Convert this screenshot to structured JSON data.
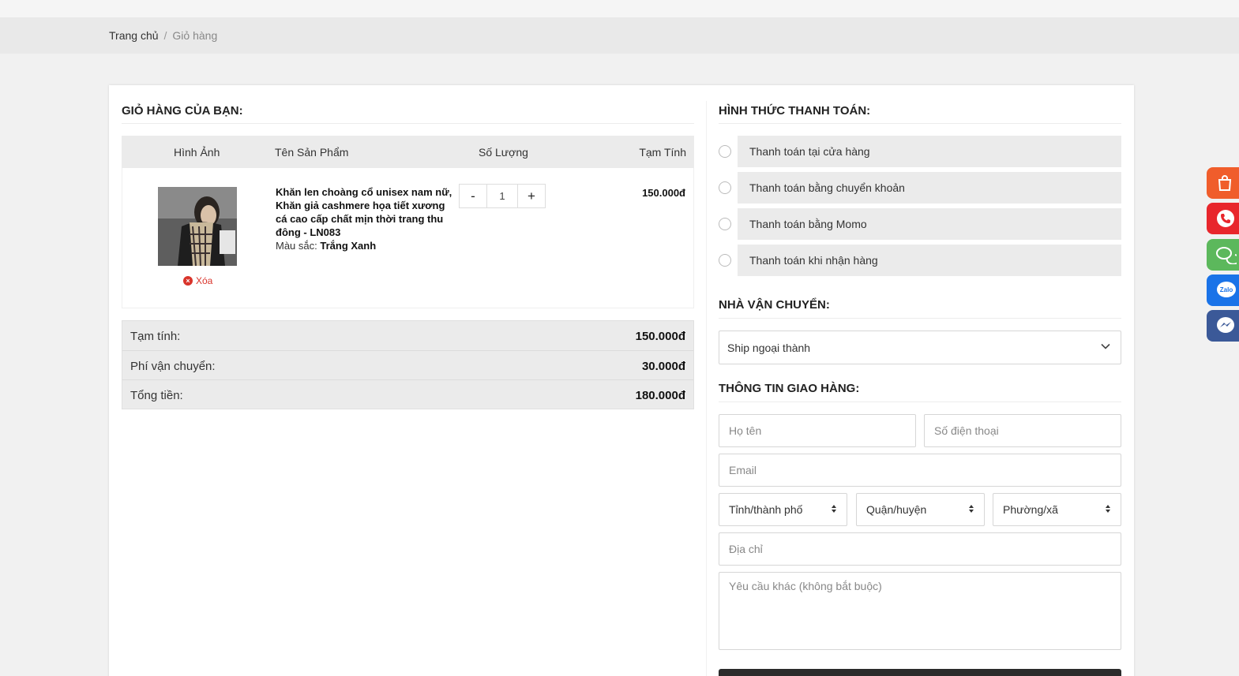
{
  "breadcrumb": {
    "home": "Trang chủ",
    "separator": "/",
    "current": "Giỏ hàng"
  },
  "cart": {
    "title": "GIỎ HÀNG CỦA BẠN:",
    "columns": [
      "Hình Ảnh",
      "Tên Sản Phẩm",
      "Số Lượng",
      "Tạm Tính"
    ],
    "item": {
      "name": "Khăn len choàng cổ unisex nam nữ, Khăn giả cashmere họa tiết xương cá cao cấp chất mịn thời trang thu đông - LN083",
      "color_label": "Màu sắc:",
      "color_value": "Trắng Xanh",
      "delete_label": "Xóa",
      "qty_minus": "-",
      "qty": "1",
      "qty_plus": "+",
      "subtotal": "150.000đ"
    },
    "totals": [
      {
        "label": "Tạm tính:",
        "value": "150.000đ"
      },
      {
        "label": "Phí vận chuyển:",
        "value": "30.000đ"
      },
      {
        "label": "Tổng tiền:",
        "value": "180.000đ"
      }
    ]
  },
  "payment": {
    "title": "HÌNH THỨC THANH TOÁN:",
    "options": [
      "Thanh toán tại cửa hàng",
      "Thanh toán bằng chuyển khoản",
      "Thanh toán bằng Momo",
      "Thanh toán khi nhận hàng"
    ]
  },
  "shipping": {
    "title": "NHÀ VẬN CHUYỂN:",
    "selected": "Ship ngoại thành"
  },
  "delivery": {
    "title": "THÔNG TIN GIAO HÀNG:",
    "name_placeholder": "Họ tên",
    "phone_placeholder": "Số điện thoại",
    "email_placeholder": "Email",
    "province": "Tỉnh/thành phố",
    "district": "Quận/huyện",
    "ward": "Phường/xã",
    "address_placeholder": "Địa chỉ",
    "note_placeholder": "Yêu cầu khác (không bắt buộc)"
  },
  "floating": {
    "zalo_label": "Zalo"
  },
  "colors": {
    "delete": "#d9342b",
    "shopee": "#f05d2b",
    "phone": "#e8262c",
    "chat": "#5cb85c",
    "zalo": "#1a73e8",
    "messenger": "#3b5998"
  }
}
